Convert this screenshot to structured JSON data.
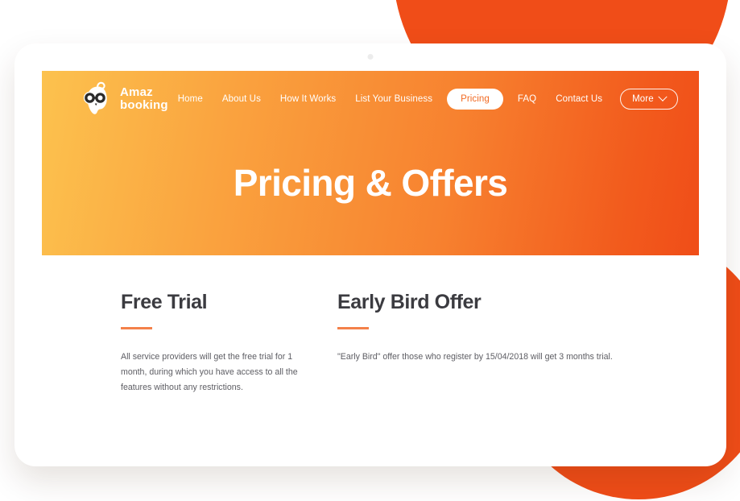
{
  "device": {
    "type": "tablet-mockup",
    "camera_icon": "camera-dot-icon"
  },
  "decoration": {
    "circle_color": "#f04d18",
    "circles": [
      "top-circle",
      "bottom-right-circle"
    ]
  },
  "brand": {
    "name_line1": "Amaz",
    "name_line2": "booking",
    "logo_icon": "owl-mascot-icon"
  },
  "nav": {
    "items": [
      {
        "label": "Home",
        "active": false
      },
      {
        "label": "About Us",
        "active": false
      },
      {
        "label": "How It Works",
        "active": false
      },
      {
        "label": "List Your Business",
        "active": false
      },
      {
        "label": "Pricing",
        "active": true
      },
      {
        "label": "FAQ",
        "active": false
      },
      {
        "label": "Contact Us",
        "active": false
      }
    ],
    "more": {
      "label": "More",
      "icon": "chevron-down-icon"
    }
  },
  "hero": {
    "title": "Pricing & Offers",
    "gradient_from": "#fcc24e",
    "gradient_to": "#f04d18"
  },
  "sections": [
    {
      "title": "Free Trial",
      "body": "All service providers will get the free trial for 1 month, during which you have access to all the features without any restrictions.",
      "rule_color": "#f4814a"
    },
    {
      "title": "Early Bird Offer",
      "body": "\"Early Bird\" offer those who register by 15/04/2018 will get 3 months trial.",
      "rule_color": "#f4814a"
    }
  ],
  "colors": {
    "accent": "#f26a22",
    "heading": "#3b3b40",
    "body_text": "#5d5d63",
    "white": "#ffffff"
  }
}
